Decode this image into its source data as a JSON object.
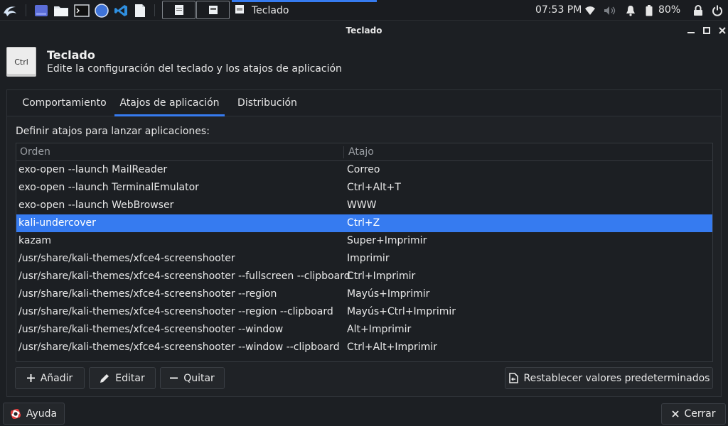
{
  "panel": {
    "clock": "07:53 PM",
    "battery": "80%",
    "task_title": "Teclado"
  },
  "window": {
    "title": "Teclado"
  },
  "header": {
    "icon_text": "Ctrl",
    "title": "Teclado",
    "subtitle": "Edite la configuración del teclado y los atajos de aplicación"
  },
  "tabs": [
    {
      "label": "Comportamiento"
    },
    {
      "label": "Atajos de aplicación"
    },
    {
      "label": "Distribución"
    }
  ],
  "shortcuts": {
    "label": "Definir atajos para lanzar aplicaciones:",
    "col_command": "Orden",
    "col_shortcut": "Atajo",
    "rows": [
      {
        "command": "exo-open --launch MailReader",
        "shortcut": "Correo"
      },
      {
        "command": "exo-open --launch TerminalEmulator",
        "shortcut": "Ctrl+Alt+T"
      },
      {
        "command": "exo-open --launch WebBrowser",
        "shortcut": "WWW"
      },
      {
        "command": "kali-undercover",
        "shortcut": "Ctrl+Z"
      },
      {
        "command": "kazam",
        "shortcut": "Super+Imprimir"
      },
      {
        "command": "/usr/share/kali-themes/xfce4-screenshooter",
        "shortcut": "Imprimir"
      },
      {
        "command": "/usr/share/kali-themes/xfce4-screenshooter --fullscreen --clipboard",
        "shortcut": "Ctrl+Imprimir"
      },
      {
        "command": "/usr/share/kali-themes/xfce4-screenshooter --region",
        "shortcut": "Mayús+Imprimir"
      },
      {
        "command": "/usr/share/kali-themes/xfce4-screenshooter --region --clipboard",
        "shortcut": "Mayús+Ctrl+Imprimir"
      },
      {
        "command": "/usr/share/kali-themes/xfce4-screenshooter --window",
        "shortcut": "Alt+Imprimir"
      },
      {
        "command": "/usr/share/kali-themes/xfce4-screenshooter --window --clipboard",
        "shortcut": "Ctrl+Alt+Imprimir"
      }
    ]
  },
  "buttons": {
    "add": "Añadir",
    "edit": "Editar",
    "remove": "Quitar",
    "reset": "Restablecer valores predeterminados",
    "help": "Ayuda",
    "close": "Cerrar"
  },
  "colors": {
    "accent": "#367bf0",
    "background": "#1c1f23"
  }
}
